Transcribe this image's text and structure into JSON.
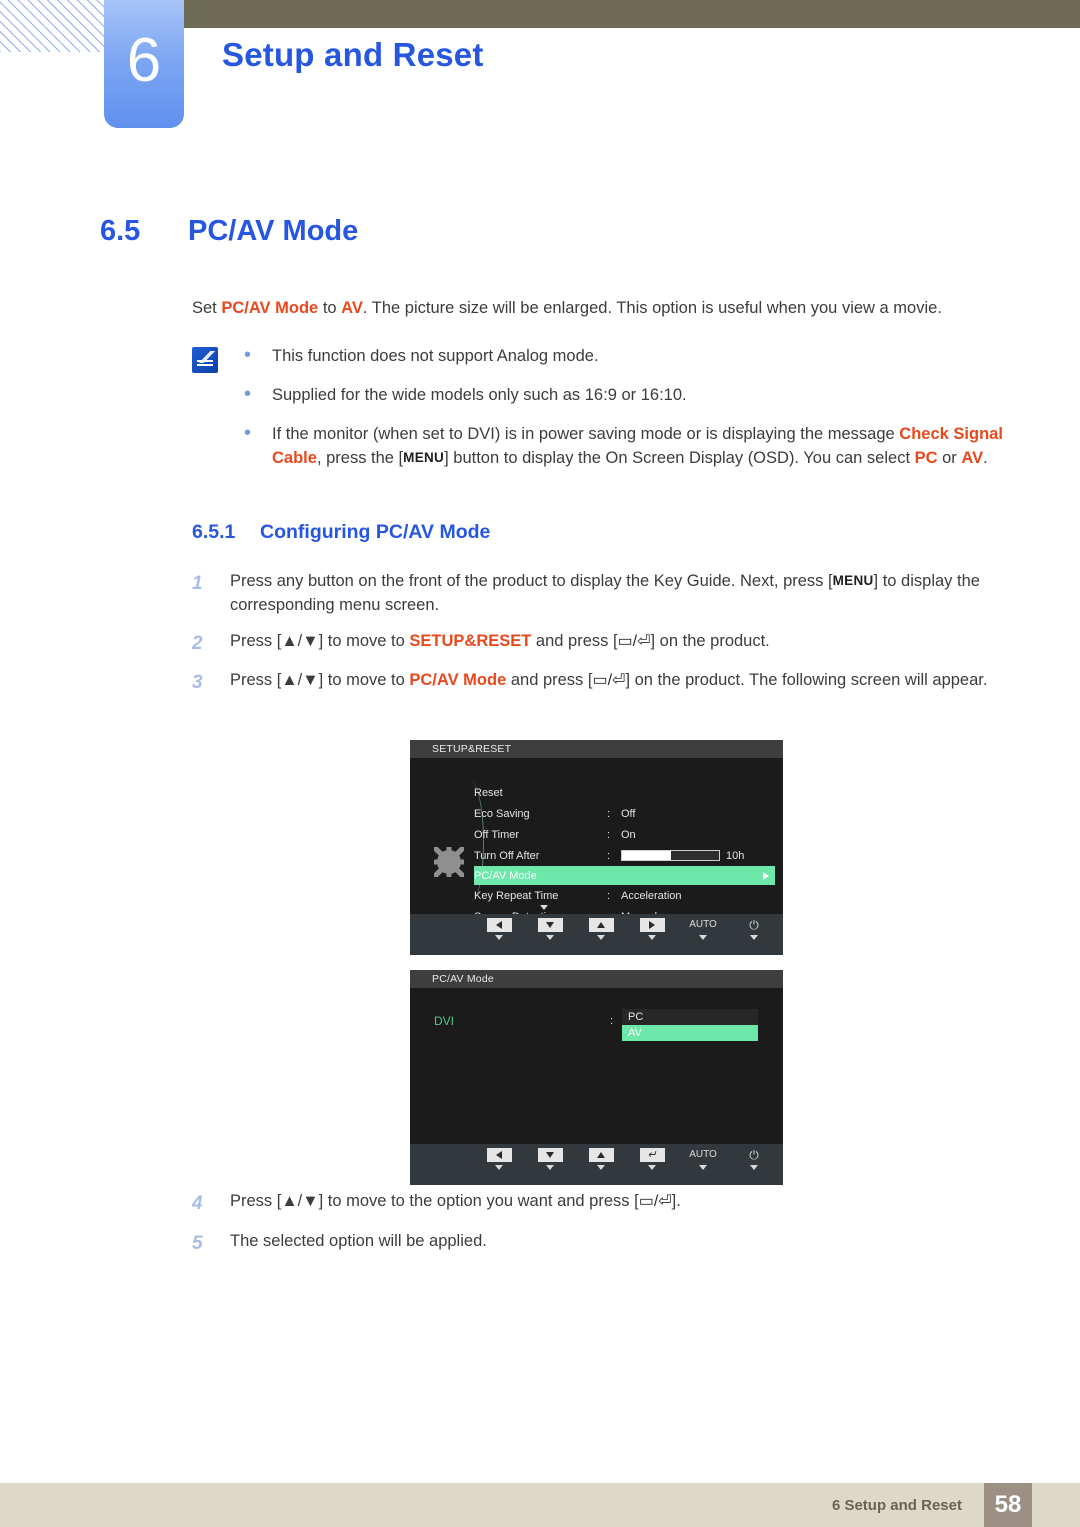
{
  "header": {
    "chapter_number": "6",
    "chapter_title": "Setup and Reset",
    "bar_color": "#6d6a56",
    "accent_color": "#2756e0"
  },
  "section": {
    "number": "6.5",
    "title": "PC/AV Mode"
  },
  "intro": {
    "prefix": "Set ",
    "term1": "PC/AV Mode",
    "mid": " to ",
    "term2": "AV",
    "suffix": ". The picture size will be enlarged. This option is useful when you view a movie."
  },
  "note": {
    "icon": "note-pencil-icon",
    "bullets": [
      {
        "text": "This function does not support Analog mode."
      },
      {
        "text": "Supplied for the wide models only such as 16:9 or 16:10."
      },
      {
        "lead": "If the monitor (when set to DVI) is in power saving mode or is displaying the message ",
        "hl1": "Check Signal Cable",
        "mid1": ", press the [",
        "key": "MENU",
        "mid2": "] button to display the On Screen Display (OSD). You can select ",
        "hl2": "PC",
        "mid3": " or ",
        "hl3": "AV",
        "tail": "."
      }
    ]
  },
  "subsection": {
    "number": "6.5.1",
    "title": "Configuring PC/AV Mode"
  },
  "steps_top": [
    {
      "n": "1",
      "a": "Press any button on the front of the product to display the Key Guide. Next, press [",
      "key": "MENU",
      "b": "] to display the corresponding menu screen."
    },
    {
      "n": "2",
      "a": "Press [▲/▼] to move to ",
      "hl": "SETUP&RESET",
      "b": " and press [",
      "glyph": "▭/⏎",
      "c": "] on the product."
    },
    {
      "n": "3",
      "a": "Press [▲/▼] to move to ",
      "hl": "PC/AV Mode",
      "b": " and press [",
      "glyph": "▭/⏎",
      "c": "] on the product. The following screen will appear."
    }
  ],
  "steps_bottom": [
    {
      "n": "4",
      "a": "Press [▲/▼] to move to the option you want and press [",
      "glyph": "▭/⏎",
      "c": "]."
    },
    {
      "n": "5",
      "a": "The selected option will be applied."
    }
  ],
  "osd1": {
    "title": "SETUP&RESET",
    "highlight_color": "#6ee7ab",
    "icon": "gear-icon",
    "rows": [
      {
        "label": "Reset",
        "sep": "",
        "value": ""
      },
      {
        "label": "Eco Saving",
        "sep": ":",
        "value": "Off"
      },
      {
        "label": "Off Timer",
        "sep": ":",
        "value": "On"
      },
      {
        "label": "Turn Off After",
        "sep": ":",
        "value": "10h",
        "slider": 50
      },
      {
        "label": "PC/AV Mode",
        "sep": "",
        "value": "",
        "selected": true
      },
      {
        "label": "Key Repeat Time",
        "sep": ":",
        "value": "Acceleration"
      },
      {
        "label": "Source Detection",
        "sep": ":",
        "value": "Manual"
      }
    ],
    "keys": [
      {
        "name": "left-arrow-key",
        "glyph": "left"
      },
      {
        "name": "down-arrow-key",
        "glyph": "down"
      },
      {
        "name": "up-arrow-key",
        "glyph": "up"
      },
      {
        "name": "right-arrow-key",
        "glyph": "right"
      },
      {
        "name": "auto-key",
        "glyph": "text",
        "label": "AUTO"
      },
      {
        "name": "power-key",
        "glyph": "power",
        "label": "⏻"
      }
    ]
  },
  "osd2": {
    "title": "PC/AV Mode",
    "source_label": "DVI",
    "separator": ":",
    "options": [
      {
        "label": "PC",
        "selected": false
      },
      {
        "label": "AV",
        "selected": true
      }
    ],
    "keys": [
      {
        "name": "left-arrow-key",
        "glyph": "left"
      },
      {
        "name": "down-arrow-key",
        "glyph": "down"
      },
      {
        "name": "up-arrow-key",
        "glyph": "up"
      },
      {
        "name": "enter-key",
        "glyph": "enter",
        "label": "↵"
      },
      {
        "name": "auto-key",
        "glyph": "text",
        "label": "AUTO"
      },
      {
        "name": "power-key",
        "glyph": "power",
        "label": "⏻"
      }
    ]
  },
  "footer": {
    "text": "6 Setup and Reset",
    "page": "58",
    "bar_color": "#ddd9c7",
    "page_box_color": "#9b9083"
  }
}
